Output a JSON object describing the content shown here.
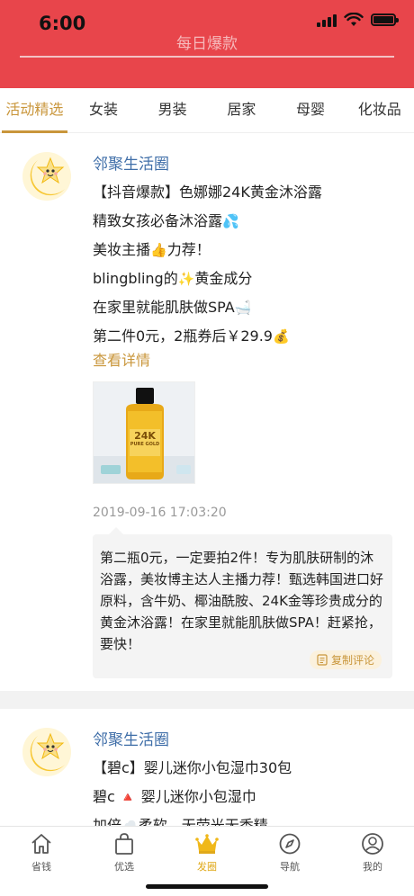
{
  "status_bar": {
    "time": "6:00"
  },
  "header": {
    "title": "每日爆款"
  },
  "tabs": [
    {
      "label": "活动精选",
      "active": true
    },
    {
      "label": "女装",
      "active": false
    },
    {
      "label": "男装",
      "active": false
    },
    {
      "label": "居家",
      "active": false
    },
    {
      "label": "母婴",
      "active": false
    },
    {
      "label": "化妆品",
      "active": false
    }
  ],
  "posts": [
    {
      "author": "邻聚生活圈",
      "lines": [
        "【抖音爆款】色娜娜24K黄金沐浴露",
        "精致女孩必备沐浴露",
        "美妆主播",
        "力荐！",
        "blingbling的",
        "黄金成分",
        "在家里就能肌肤做SPA",
        "第二件0元，2瓶券后￥29.9"
      ],
      "more_link": "查看详情",
      "product_image": {
        "brand_line1": "24K",
        "brand_line2": "PURE GOLD"
      },
      "timestamp": "2019-09-16 17:03:20",
      "comment": "第二瓶0元，一定要拍2件！专为肌肤研制的沐浴露，美妆博主达人主播力荐！甄选韩国进口好原料，含牛奶、椰油酰胺、24K金等珍贵成分的黄金沐浴露！在家里就能肌肤做SPA！赶紧抢，要快！",
      "copy_label": "复制评论"
    },
    {
      "author": "邻聚生活圈",
      "lines": [
        "【碧c】婴儿迷你小包湿巾30包",
        "碧c",
        "婴儿迷你小包湿巾",
        "加倍",
        "柔软，无荧光无香精"
      ]
    }
  ],
  "bottom_nav": [
    {
      "label": "省钱",
      "icon": "home-icon",
      "active": false
    },
    {
      "label": "优选",
      "icon": "shopping-bag-icon",
      "active": false
    },
    {
      "label": "发圈",
      "icon": "crown-icon",
      "active": true
    },
    {
      "label": "导航",
      "icon": "compass-icon",
      "active": false
    },
    {
      "label": "我的",
      "icon": "user-icon",
      "active": false
    }
  ],
  "colors": {
    "header": "#e8454b",
    "accent": "#c9963b",
    "link": "#3f6ea8",
    "active_nav": "#e0a91a"
  }
}
